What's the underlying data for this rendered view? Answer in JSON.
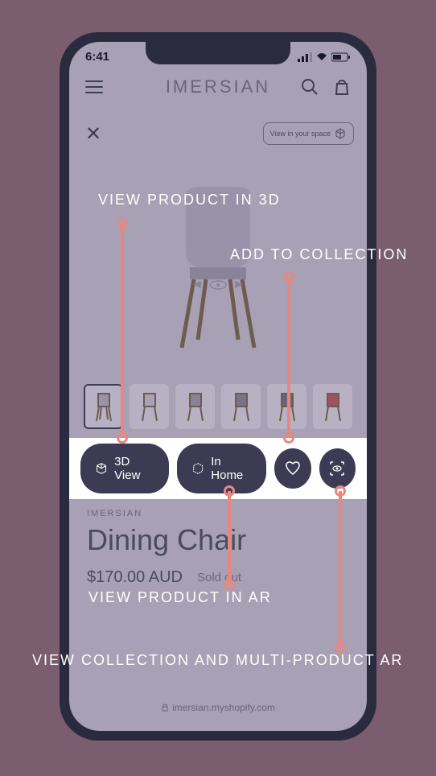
{
  "status": {
    "time": "6:41"
  },
  "header": {
    "logo": "IMERSIAN"
  },
  "viewer": {
    "view_in_space": "View in your space"
  },
  "actions": {
    "view_3d": "3D View",
    "in_home": "In Home"
  },
  "product": {
    "brand": "IMERSIAN",
    "title": "Dining Chair",
    "price": "$170.00 AUD",
    "availability": "Sold out"
  },
  "url": "imersian.myshopify.com",
  "annotations": {
    "view_3d": "VIEW PRODUCT IN 3D",
    "add_collection": "ADD TO COLLECTION",
    "view_ar": "VIEW PRODUCT IN AR",
    "multi_ar": "VIEW COLLECTION AND MULTI-PRODUCT AR"
  }
}
